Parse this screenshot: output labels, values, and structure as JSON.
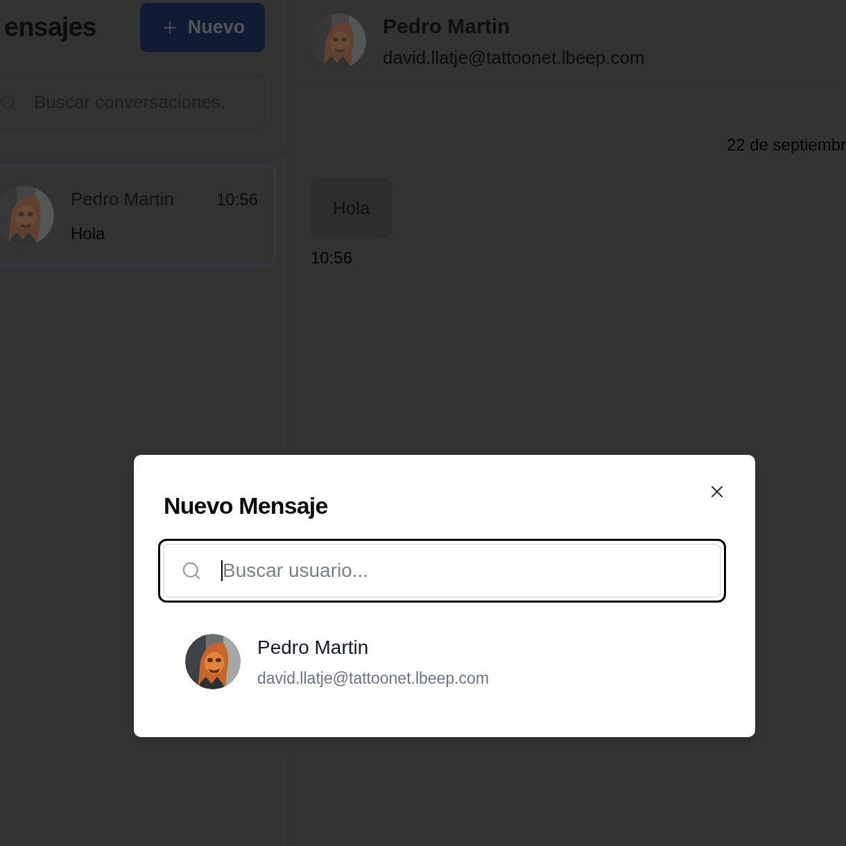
{
  "sidebar": {
    "title": "ensajes",
    "new_button": {
      "label": "Nuevo"
    },
    "search": {
      "placeholder": "Buscar conversaciones."
    },
    "conversations": [
      {
        "name": "Pedro Martin",
        "time": "10:56",
        "preview": "Hola",
        "selected": true
      }
    ]
  },
  "chat": {
    "header": {
      "name": "Pedro Martin",
      "email": "david.llatje@tattoonet.lbeep.com"
    },
    "date": "22 de septiembr",
    "messages": [
      {
        "text": "Hola",
        "time": "10:56"
      }
    ]
  },
  "modal": {
    "title": "Nuevo Mensaje",
    "search": {
      "placeholder": "Buscar usuario..."
    },
    "users": [
      {
        "name": "Pedro Martin",
        "email": "david.llatje@tattoonet.lbeep.com"
      }
    ]
  }
}
